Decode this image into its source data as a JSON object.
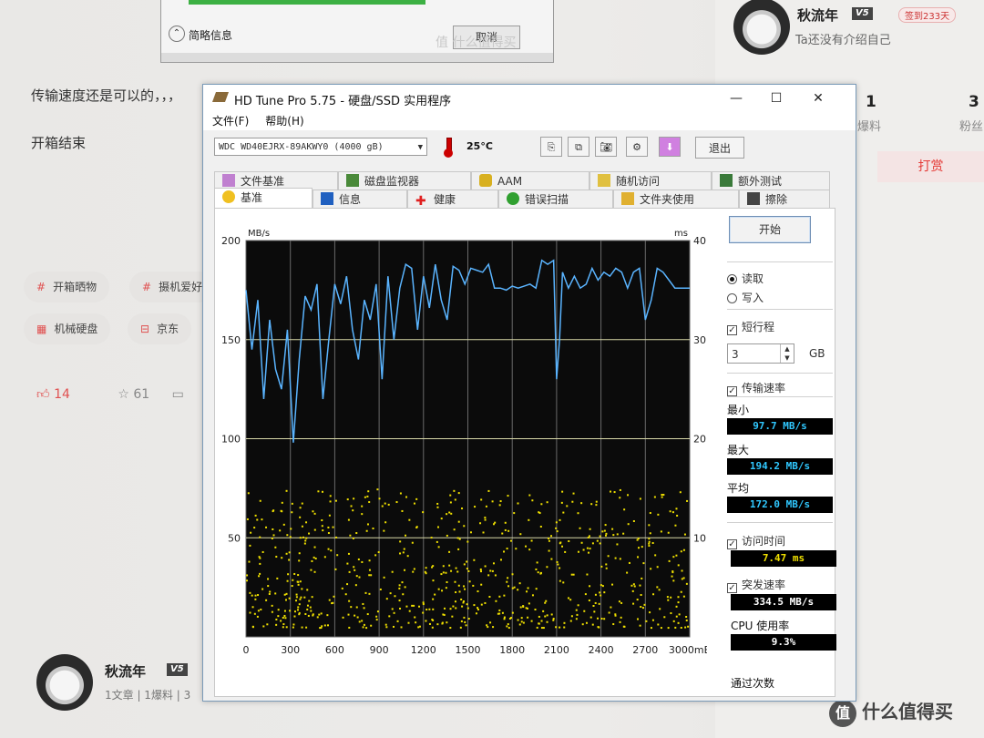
{
  "page": {
    "prev_window": {
      "collapse_label": "简略信息",
      "cancel_label": "取消",
      "watermark": "值 什么值得买"
    },
    "para1": "传输速度还是可以的，，，",
    "para2": "开箱结束",
    "tags": [
      "开箱晒物",
      "摄机爱好",
      "机械硬盘",
      "京东"
    ],
    "likes": "14",
    "favorites": "61"
  },
  "author_card": {
    "name": "秋流年",
    "level": "V5",
    "checkin": "签到233天",
    "bio": "Ta还没有介绍自己",
    "stats": [
      {
        "value": "1",
        "label": "爆料"
      },
      {
        "value": "3",
        "label": "粉丝"
      }
    ],
    "tip_label": "打赏",
    "logo_text": "什么值得买",
    "logo_icon": "值"
  },
  "bottom_author": {
    "name": "秋流年",
    "level": "V5",
    "meta": "1文章 | 1爆料 | 3"
  },
  "window": {
    "title": "HD Tune Pro 5.75 - 硬盘/SSD 实用程序",
    "menu": [
      "文件(F)",
      "帮助(H)"
    ],
    "drive": "WDC WD40EJRX-89AKWY0 (4000 gB)",
    "temperature": "25",
    "temperature_unit": "°C",
    "exit_label": "退出",
    "tabs_row1": [
      "文件基准",
      "磁盘监视器",
      "AAM",
      "随机访问",
      "额外测试"
    ],
    "tabs_row2": [
      "基准",
      "信息",
      "健康",
      "错误扫描",
      "文件夹使用",
      "擦除"
    ],
    "active_tab": "基准"
  },
  "side": {
    "start_label": "开始",
    "read_label": "读取",
    "write_label": "写入",
    "short_stroke_label": "短行程",
    "short_stroke_value": "3",
    "short_stroke_unit": "GB",
    "transfer_rate_label": "传输速率",
    "min_label": "最小",
    "min_value": "97.7 MB/s",
    "max_label": "最大",
    "max_value": "194.2 MB/s",
    "avg_label": "平均",
    "avg_value": "172.0 MB/s",
    "access_time_label": "访问时间",
    "access_time_value": "7.47 ms",
    "burst_label": "突发速率",
    "burst_value": "334.5 MB/s",
    "cpu_label": "CPU 使用率",
    "cpu_value": "9.3%",
    "passes_label": "通过次数"
  },
  "chart_data": {
    "type": "line",
    "ylabel_left": "MB/s",
    "ylabel_right": "ms",
    "xunit": "mB",
    "xlim": [
      0,
      3000
    ],
    "ylim": [
      0,
      200
    ],
    "y2lim": [
      0,
      40
    ],
    "x_ticks": [
      "0",
      "300",
      "600",
      "900",
      "1200",
      "1500",
      "1800",
      "2100",
      "2400",
      "2700",
      "3000mB"
    ],
    "y_ticks": [
      "50",
      "100",
      "150",
      "200"
    ],
    "y2_ticks": [
      "10",
      "20",
      "30",
      "40"
    ],
    "transfer_rate": {
      "name": "传输速率",
      "color": "#5ab4ff",
      "x": [
        0,
        40,
        80,
        120,
        160,
        200,
        240,
        280,
        320,
        360,
        400,
        440,
        480,
        520,
        560,
        600,
        640,
        680,
        720,
        760,
        800,
        840,
        880,
        920,
        960,
        1000,
        1040,
        1080,
        1120,
        1160,
        1200,
        1240,
        1280,
        1320,
        1360,
        1400,
        1440,
        1480,
        1520,
        1560,
        1600,
        1640,
        1680,
        1720,
        1760,
        1800,
        1840,
        1880,
        1920,
        1960,
        2000,
        2040,
        2080,
        2100,
        2120,
        2140,
        2180,
        2220,
        2260,
        2300,
        2340,
        2380,
        2420,
        2460,
        2500,
        2540,
        2580,
        2620,
        2660,
        2700,
        2740,
        2780,
        2820,
        2860,
        2900,
        2940,
        2980,
        3000
      ],
      "y": [
        175,
        145,
        170,
        120,
        160,
        135,
        125,
        155,
        98,
        140,
        172,
        165,
        178,
        120,
        150,
        178,
        168,
        182,
        155,
        140,
        170,
        160,
        178,
        130,
        182,
        150,
        176,
        188,
        186,
        155,
        182,
        166,
        188,
        170,
        160,
        187,
        185,
        178,
        186,
        185,
        184,
        188,
        176,
        176,
        175,
        177,
        176,
        177,
        178,
        176,
        190,
        188,
        190,
        130,
        150,
        184,
        176,
        182,
        176,
        178,
        186,
        180,
        184,
        182,
        186,
        184,
        176,
        184,
        186,
        160,
        170,
        186,
        184,
        180,
        176,
        176,
        176,
        176
      ]
    },
    "access_time": {
      "name": "访问时间",
      "color": "#f0e000",
      "summary_ms": 7.47,
      "range_ms": [
        1,
        15
      ]
    }
  }
}
